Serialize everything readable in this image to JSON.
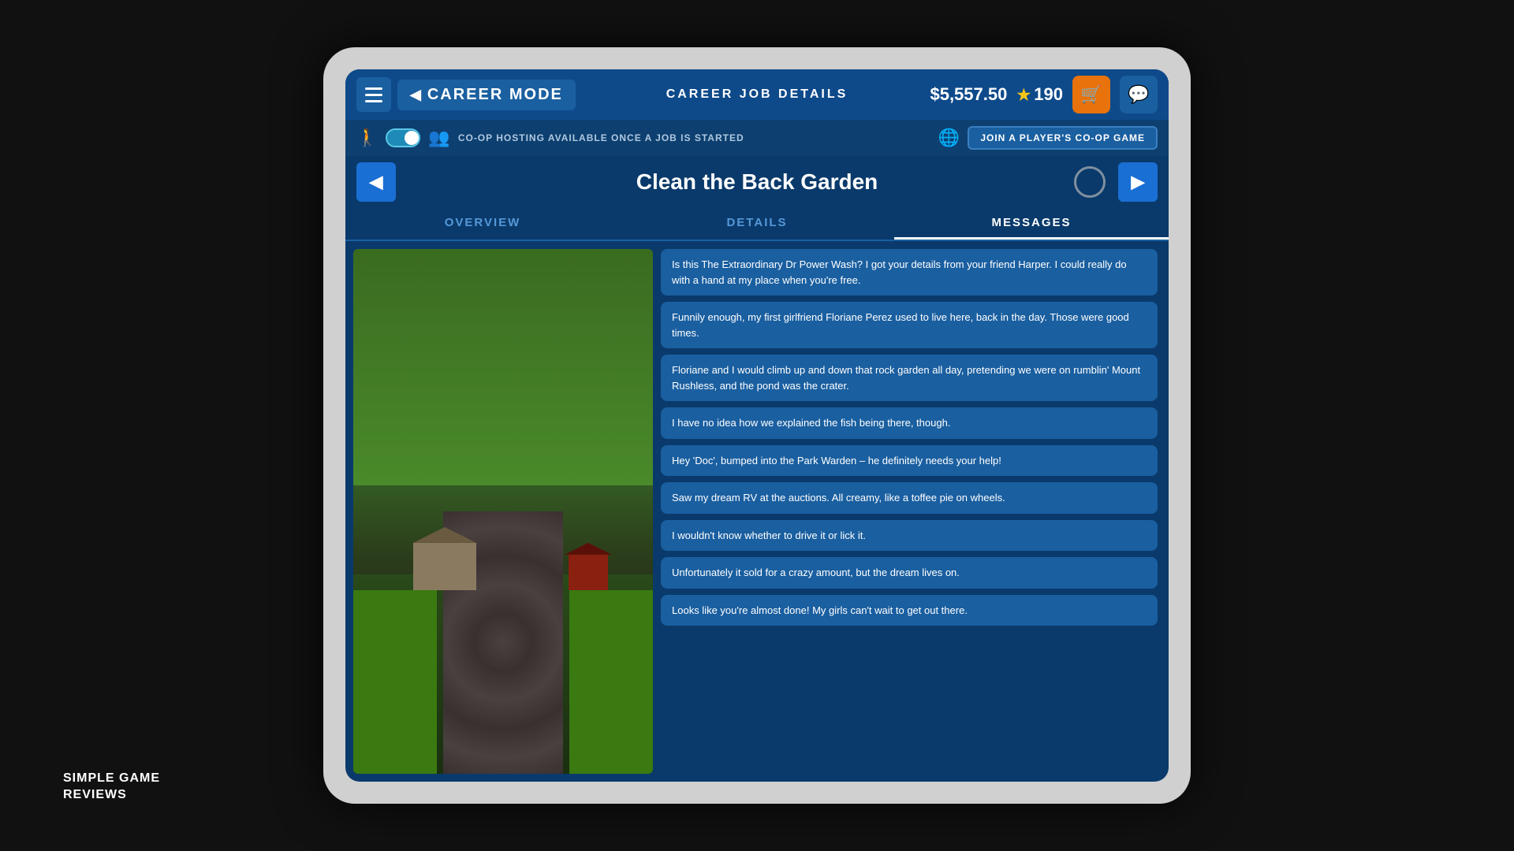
{
  "header": {
    "title": "CAREER JOB DETAILS",
    "career_mode_label": "CAREER MODE",
    "balance": "$5,557.50",
    "rating": "190",
    "back_arrow": "◀"
  },
  "coop": {
    "message": "CO-OP HOSTING AVAILABLE ONCE A JOB IS STARTED",
    "join_button": "JOIN A PLAYER'S CO-OP GAME"
  },
  "job": {
    "title": "Clean the Back Garden",
    "prev_label": "◀",
    "next_label": "▶"
  },
  "tabs": {
    "overview": "OVERVIEW",
    "details": "DETAILS",
    "messages": "MESSAGES"
  },
  "messages": [
    "Is this The Extraordinary Dr Power Wash? I got your details from your friend Harper. I could really do with a hand at my place when you're free.",
    "Funnily enough, my first girlfriend Floriane Perez used to live here, back in the day. Those were good times.",
    "Floriane and I would climb up and down that rock garden all day, pretending we were on rumblin' Mount Rushless, and the pond was the crater.",
    "I have no idea how we explained the fish being there, though.",
    "Hey 'Doc', bumped into the Park Warden – he definitely needs your help!",
    "Saw my dream RV at the auctions. All creamy, like a toffee pie on wheels.",
    "I wouldn't know whether to drive it or lick it.",
    "Unfortunately it sold for a crazy amount, but the dream lives on.",
    "Looks like you're almost done! My girls can't wait to get out there."
  ],
  "watermark": {
    "line1": "SIMPLE GAME",
    "line2": "REVIEWS"
  }
}
